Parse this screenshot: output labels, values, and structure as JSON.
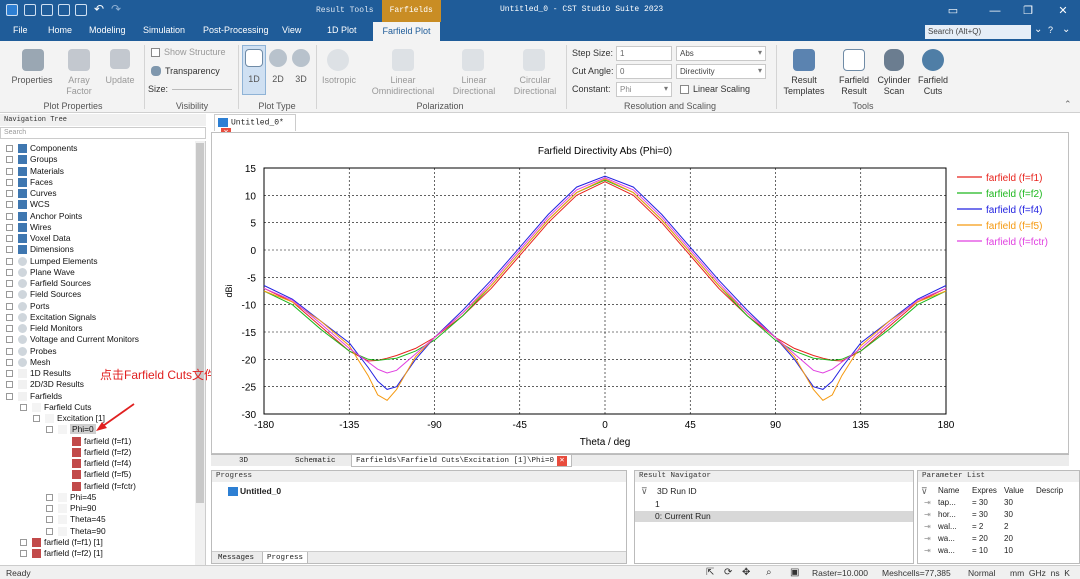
{
  "app": {
    "window_title": "Untitled_0 - CST Studio Suite 2023",
    "context_tabs": [
      "Result Tools",
      "Farfields"
    ]
  },
  "menu": [
    "File",
    "Home",
    "Modeling",
    "Simulation",
    "Post-Processing",
    "View",
    "1D Plot",
    "Farfield Plot"
  ],
  "search_placeholder": "Search (Alt+Q)",
  "ribbon": {
    "properties": "Properties",
    "array_factor": "Array\nFactor",
    "update": "Update",
    "plot_properties": "Plot Properties",
    "show_structure": "Show Structure",
    "transparency": "Transparency",
    "size": "Size:",
    "visibility": "Visibility",
    "d1": "1D",
    "d2": "2D",
    "d3": "3D",
    "plot_type": "Plot Type",
    "isotropic": "Isotropic",
    "lin_omni": "Linear\nOmnidirectional",
    "lin_dir": "Linear\nDirectional",
    "circ_dir": "Circular\nDirectional",
    "polarization": "Polarization",
    "step_size": "Step Size:",
    "step_val": "1",
    "cut_angle": "Cut Angle:",
    "cut_val": "0",
    "constant": "Constant:",
    "const_val": "Phi",
    "abs": "Abs",
    "directivity": "Directivity",
    "linear_scaling": "Linear Scaling",
    "resolution": "Resolution and Scaling",
    "result_templates": "Result\nTemplates",
    "farfield_result": "Farfield\nResult",
    "cylinder_scan": "Cylinder\nScan",
    "farfield_cuts": "Farfield\nCuts",
    "tools": "Tools"
  },
  "nav": {
    "title": "Navigation Tree",
    "search": "Search",
    "items": [
      "Components",
      "Groups",
      "Materials",
      "Faces",
      "Curves",
      "WCS",
      "Anchor Points",
      "Wires",
      "Voxel Data",
      "Dimensions",
      "Lumped Elements",
      "Plane Wave",
      "Farfield Sources",
      "Field Sources",
      "Ports",
      "Excitation Signals",
      "Field Monitors",
      "Voltage and Current Monitors",
      "Probes",
      "Mesh",
      "1D Results",
      "2D/3D Results",
      "Farfields"
    ],
    "farfield_cuts": "Farfield Cuts",
    "excitation": "Excitation [1]",
    "phi0": "Phi=0",
    "cuts": [
      "farfield (f=f1)",
      "farfield (f=f2)",
      "farfield (f=f4)",
      "farfield (f=f5)",
      "farfield (f=fctr)"
    ],
    "others": [
      "Phi=45",
      "Phi=90",
      "Theta=45",
      "Theta=90"
    ],
    "bottom": [
      "farfield (f=f1) [1]",
      "farfield (f=f2) [1]"
    ]
  },
  "annotation": "点击Farfield Cuts文件夹查看远场结果。",
  "doc_tab": "Untitled_0*",
  "view_tabs": [
    "3D",
    "Schematic",
    "Farfields\\Farfield Cuts\\Excitation [1]\\Phi=0"
  ],
  "progress": {
    "title": "Progress",
    "item": "Untitled_0",
    "tabs": [
      "Messages",
      "Progress"
    ]
  },
  "result_nav": {
    "title": "Result Navigator",
    "col": "3D Run ID",
    "rows": [
      "1",
      "0: Current Run"
    ]
  },
  "param_list": {
    "title": "Parameter List",
    "cols": [
      "Name",
      "Expres",
      "Value",
      "Descrip"
    ],
    "rows": [
      [
        "tap...",
        "= 30",
        "30"
      ],
      [
        "hor...",
        "= 30",
        "30"
      ],
      [
        "wal...",
        "= 2",
        "2"
      ],
      [
        "wa...",
        "= 20",
        "20"
      ],
      [
        "wa...",
        "= 10",
        "10"
      ]
    ]
  },
  "status": {
    "ready": "Ready",
    "raster": "Raster=10.000",
    "meshcells": "Meshcells=77,385",
    "mode": "Normal",
    "units": "mm  GHz  ns  K"
  },
  "colors": {
    "f1": "#e8231c",
    "f2": "#1fb81f",
    "f4": "#2222e0",
    "f5": "#f59a12",
    "fctr": "#e040e0"
  },
  "chart_data": {
    "type": "line",
    "title": "Farfield Directivity Abs (Phi=0)",
    "xlabel": "Theta / deg",
    "ylabel": "dBi",
    "xlim": [
      -180,
      180
    ],
    "ylim": [
      -30,
      15
    ],
    "xticks": [
      -180,
      -135,
      -90,
      -45,
      0,
      45,
      90,
      135,
      180
    ],
    "yticks": [
      15,
      10,
      5,
      0,
      -5,
      -10,
      -15,
      -20,
      -25,
      -30
    ],
    "grid": true,
    "legend": "top-right",
    "x": [
      -180,
      -165,
      -150,
      -135,
      -125,
      -120,
      -115,
      -110,
      -100,
      -90,
      -75,
      -60,
      -45,
      -30,
      -15,
      0,
      15,
      30,
      45,
      60,
      75,
      90,
      100,
      110,
      115,
      120,
      125,
      135,
      150,
      165,
      180
    ],
    "series": [
      {
        "name": "farfield (f=f1)",
        "values": [
          -7,
          -9.5,
          -14,
          -18.5,
          -20.3,
          -20.2,
          -19.8,
          -19.3,
          -18,
          -16,
          -12,
          -7,
          -1,
          5,
          10,
          12.5,
          10,
          5,
          -1,
          -7,
          -12,
          -16,
          -18,
          -19.3,
          -19.8,
          -20.2,
          -20.3,
          -18.5,
          -14,
          -9.5,
          -7
        ]
      },
      {
        "name": "farfield (f=f2)",
        "values": [
          -7.5,
          -10,
          -14.5,
          -18.5,
          -20,
          -20.2,
          -20,
          -19.8,
          -18.5,
          -16.5,
          -12,
          -6.5,
          -0.5,
          5.5,
          10.5,
          12.8,
          10.5,
          5.5,
          -0.5,
          -6.5,
          -12,
          -16.5,
          -18.5,
          -19.8,
          -20,
          -20.2,
          -20,
          -18.5,
          -14.5,
          -10,
          -7.5
        ]
      },
      {
        "name": "farfield (f=f4)",
        "values": [
          -6.5,
          -9,
          -13,
          -17,
          -21.5,
          -24,
          -25.5,
          -25,
          -20,
          -16,
          -11,
          -5.5,
          0.5,
          6.5,
          11.5,
          13.5,
          11.5,
          6.5,
          0.5,
          -5.5,
          -11,
          -16,
          -20,
          -25,
          -25.5,
          -24,
          -21.5,
          -17,
          -13,
          -9,
          -6.5
        ]
      },
      {
        "name": "farfield (f=f5)",
        "values": [
          -7.5,
          -9.5,
          -13,
          -17.5,
          -23,
          -26.5,
          -27.5,
          -25.5,
          -19.5,
          -16,
          -11.5,
          -6.5,
          -0.5,
          5.5,
          10.5,
          13,
          10.5,
          5.5,
          -0.5,
          -6.5,
          -11.5,
          -16,
          -19.5,
          -25.5,
          -27.5,
          -26.5,
          -23,
          -17.5,
          -13,
          -9.5,
          -7.5
        ]
      },
      {
        "name": "farfield (f=fctr)",
        "values": [
          -7,
          -9.2,
          -13.5,
          -18,
          -20.5,
          -21.8,
          -22.5,
          -22,
          -19,
          -16,
          -11.5,
          -6,
          0,
          6,
          11,
          13.2,
          11,
          6,
          0,
          -6,
          -11.5,
          -16,
          -19,
          -22,
          -22.5,
          -21.8,
          -20.5,
          -18,
          -13.5,
          -9.2,
          -7
        ]
      }
    ]
  }
}
